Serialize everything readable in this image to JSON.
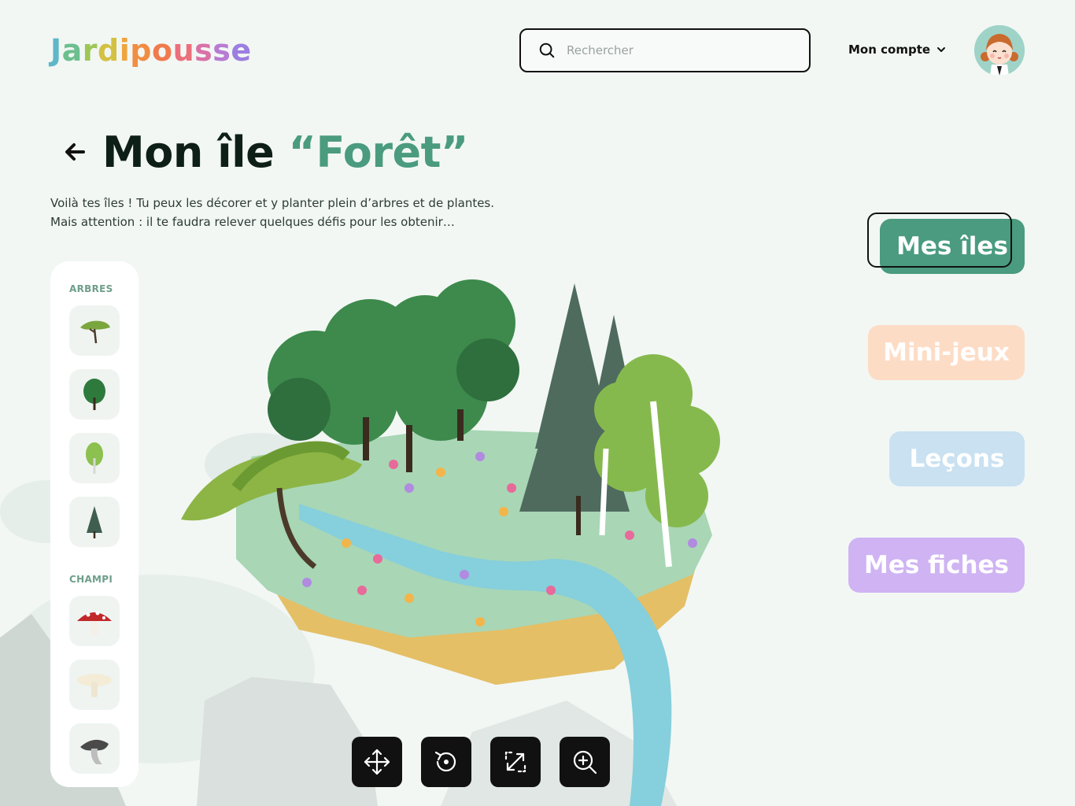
{
  "header": {
    "logo_letters": [
      "J",
      "a",
      "r",
      "d",
      "i",
      "p",
      "o",
      "u",
      "s",
      "s",
      "e"
    ],
    "search_placeholder": "Rechercher",
    "account_label": "Mon compte"
  },
  "page": {
    "title_prefix": "Mon île ",
    "title_accent": "“Forêt”",
    "subtitle_line1": "Voilà tes îles ! Tu peux les décorer et y planter plein d’arbres et de plantes.",
    "subtitle_line2": "Mais attention : il te faudra relever quelques défis pour les obtenir…"
  },
  "palette": {
    "sections": [
      {
        "label": "ARBRES",
        "items": [
          "acacia-tree-icon",
          "leafy-tree-icon",
          "birch-tree-icon",
          "fir-tree-icon"
        ]
      },
      {
        "label": "CHAMPI",
        "items": [
          "red-mushroom-icon",
          "white-mushroom-icon",
          "grey-mushroom-icon"
        ]
      }
    ]
  },
  "nav": {
    "islands": "Mes îles",
    "games": "Mini-jeux",
    "lessons": "Leçons",
    "sheets": "Mes fiches"
  },
  "toolbar": {
    "tools": [
      "move-icon",
      "rotate-icon",
      "resize-icon",
      "zoom-in-icon"
    ]
  },
  "colors": {
    "accent": "#4a9b7f",
    "games": "#fddcc6",
    "lessons": "#c9e1f1",
    "sheets": "#cfb3f3",
    "background": "#f2f7f4"
  }
}
